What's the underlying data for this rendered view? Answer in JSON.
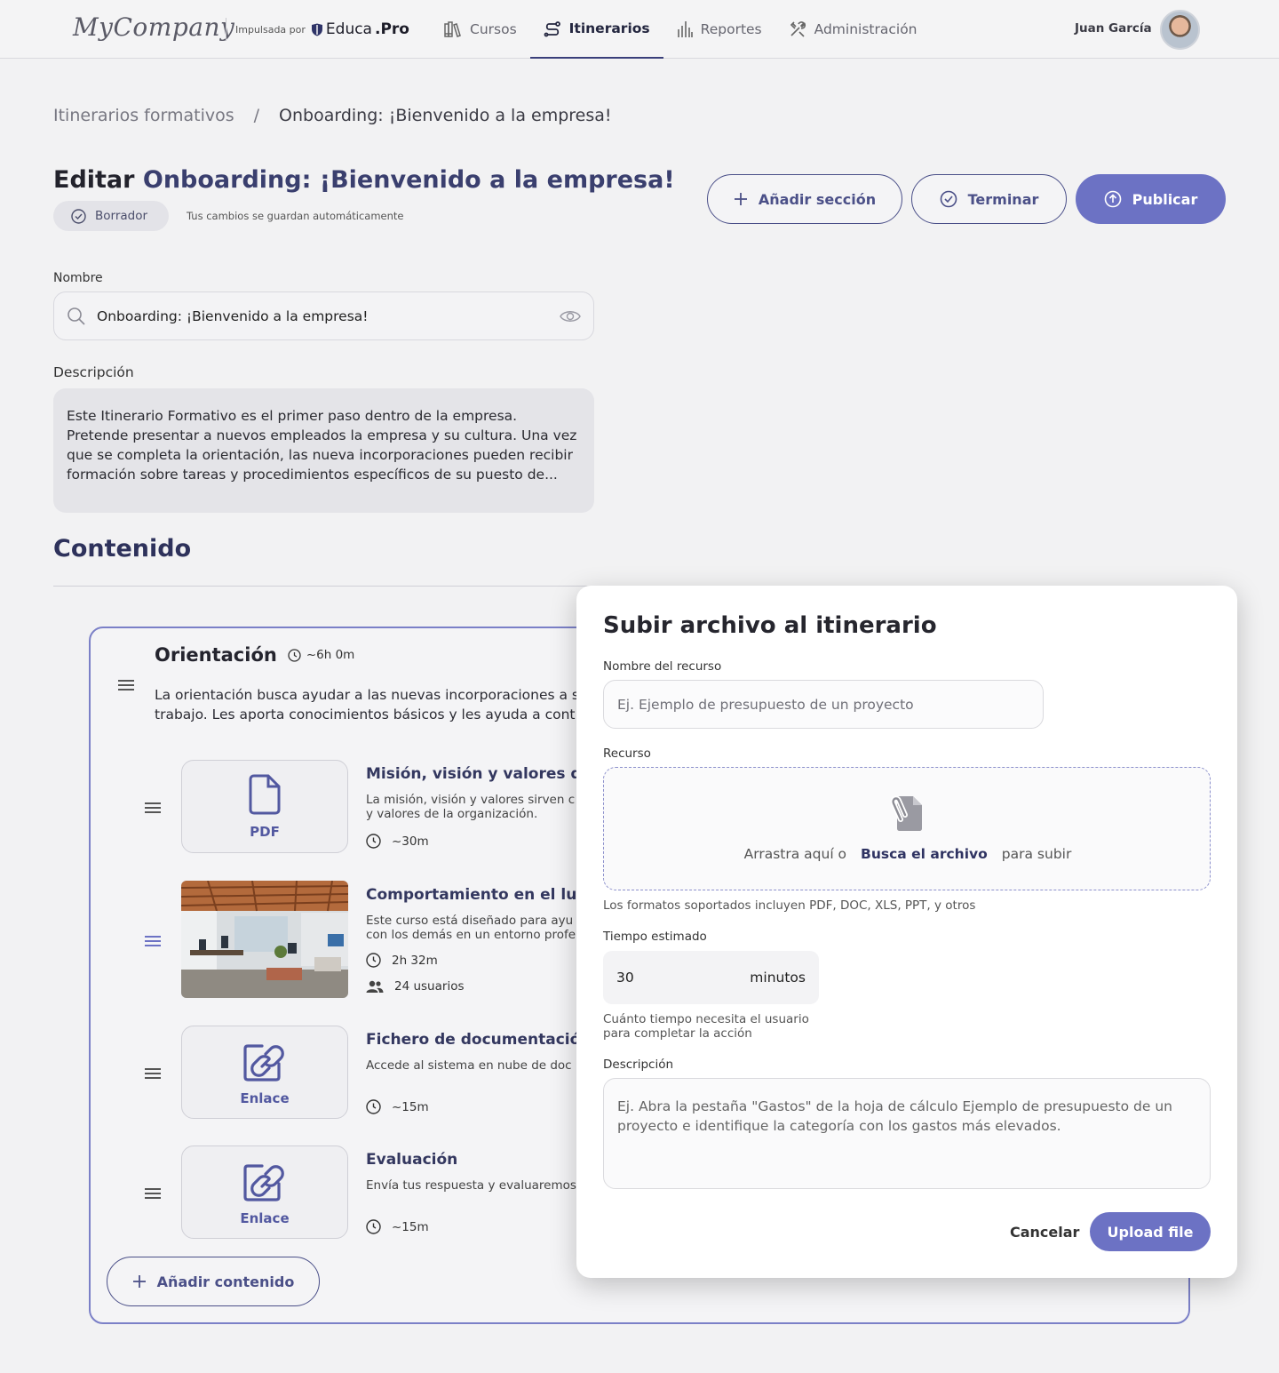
{
  "header": {
    "logo": "MyCompany",
    "powered_by": "Impulsada por",
    "brand_name": "Educa",
    "brand_suffix": ".Pro",
    "nav": [
      {
        "label": "Cursos",
        "icon": "books-icon",
        "active": false
      },
      {
        "label": "Itinerarios",
        "icon": "route-icon",
        "active": true
      },
      {
        "label": "Reportes",
        "icon": "bar-chart-icon",
        "active": false
      },
      {
        "label": "Administración",
        "icon": "tools-icon",
        "active": false
      }
    ],
    "user_name": "Juan García"
  },
  "breadcrumb": {
    "parent": "Itinerarios formativos",
    "separator": "/",
    "current": "Onboarding: ¡Bienvenido a la empresa!"
  },
  "page": {
    "title_prefix": "Editar",
    "title_name": "Onboarding: ¡Bienvenido a la empresa!",
    "status": "Borrador",
    "autosave": "Tus cambios se guardan automáticamente",
    "actions": {
      "add_section": "Añadir sección",
      "finish": "Terminar",
      "publish": "Publicar"
    }
  },
  "form": {
    "name_label": "Nombre",
    "name_value": "Onboarding: ¡Bienvenido a la empresa!",
    "description_label": "Descripción",
    "description_value": "Este Itinerario Formativo es el primer paso dentro de la empresa. Pretende presentar a nuevos empleados la empresa y su cultura. Una vez que se completa la orientación, las nueva incorporaciones pueden recibir formación sobre tareas y procedimientos específicos de su puesto de..."
  },
  "content": {
    "heading": "Contenido",
    "section": {
      "title": "Orientación",
      "duration": "~6h 0m",
      "description_line1": "La orientación busca ayudar a las nuevas incorporaciones a s",
      "description_line2": "trabajo. Les aporta conocimientos básicos y les ayuda a cont",
      "items": [
        {
          "tile": "PDF",
          "title": "Misión, visión y valores de",
          "desc1": "La misión, visión y valores sirven c",
          "desc2": "y valores de la organización.",
          "time": "~30m"
        },
        {
          "tile": "",
          "title": "Comportamiento en el luga",
          "desc1": "Este curso está diseñado para ayu",
          "desc2": "con los demás en un entorno profe",
          "time": "2h 32m",
          "users": "24 usuarios"
        },
        {
          "tile": "Enlace",
          "title": "Fichero de documentación",
          "desc1": "Accede al sistema en nube de doc",
          "time": "~15m"
        },
        {
          "tile": "Enlace",
          "title": "Evaluación",
          "desc1": "Envía tus respuesta y evaluaremos",
          "time": "~15m"
        }
      ],
      "add_content": "Añadir contenido"
    }
  },
  "modal": {
    "title": "Subir archivo al itinerario",
    "resource_name_label": "Nombre del recurso",
    "resource_name_placeholder": "Ej. Ejemplo de presupuesto de un proyecto",
    "resource_label": "Recurso",
    "drop_prefix": "Arrastra aquí o",
    "drop_link": "Busca el archivo",
    "drop_suffix": "para subir",
    "formats_hint": "Los formatos soportados incluyen PDF, DOC, XLS, PPT, y otros",
    "time_label": "Tiempo estimado",
    "time_value": "30",
    "time_unit": "minutos",
    "time_hint_1": "Cuánto tiempo necesita el usuario",
    "time_hint_2": "para completar la acción",
    "desc_label": "Descripción",
    "desc_placeholder": "Ej. Abra la pestaña \"Gastos\" de la hoja de cálculo Ejemplo de presupuesto de un proyecto e identifique la categoría con los gastos más elevados.",
    "cancel": "Cancelar",
    "upload": "Upload file"
  },
  "colors": {
    "accent": "#6c72c4",
    "navy": "#3a3f6e",
    "border": "#7b80c7"
  }
}
